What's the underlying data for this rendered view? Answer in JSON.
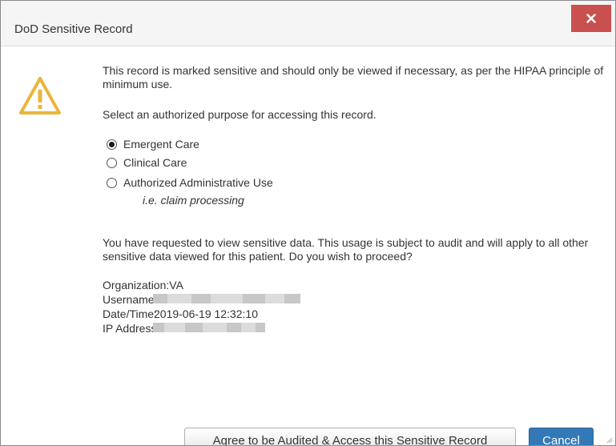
{
  "dialog": {
    "title": "DoD Sensitive Record",
    "close_label": "×",
    "warning_text": "This record is marked sensitive and should only be viewed if necessary, as per the HIPAA principle of minimum use.",
    "select_prompt": "Select an authorized purpose for accessing this record.",
    "purposes": [
      {
        "label": "Emergent Care",
        "checked": true
      },
      {
        "label": "Clinical Care",
        "checked": false
      },
      {
        "label": "Authorized Administrative Use",
        "checked": false
      }
    ],
    "purpose_hint": "i.e. claim processing",
    "audit_notice": "You have requested to view sensitive data. This usage is subject to audit and will apply to all other sensitive data viewed for this patient. Do you wish to proceed?",
    "info": {
      "organization_label": "Organization:",
      "organization_value": "VA",
      "username_label": "Username:",
      "datetime_label": "Date/Time:",
      "datetime_value": "2019-06-19 12:32:10",
      "ip_label": "IP Address:"
    },
    "agree_button": "Agree to be Audited & Access this Sensitive Record",
    "cancel_button": "Cancel",
    "colors": {
      "close_bg": "#c9504f",
      "primary_button": "#3379b7",
      "warning_icon": "#eab53a"
    },
    "icons": {
      "warning": "warning-triangle-icon",
      "close": "close-icon"
    }
  }
}
